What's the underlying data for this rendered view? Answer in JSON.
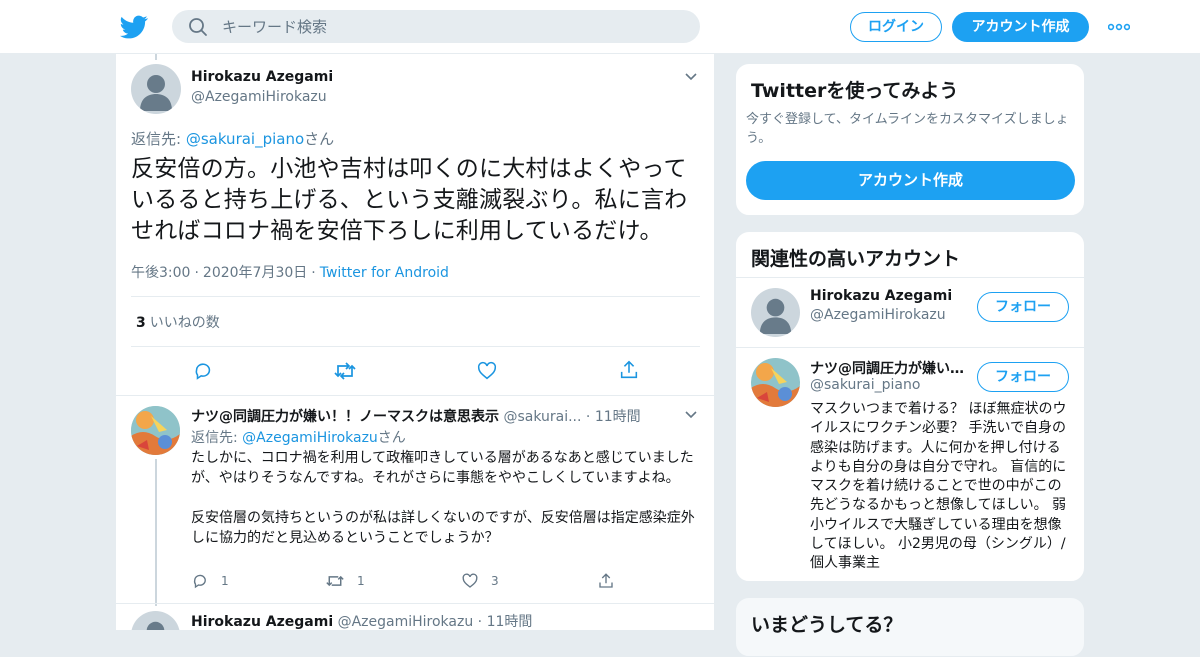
{
  "header": {
    "search_placeholder": "キーワード検索",
    "login_label": "ログイン",
    "signup_label": "アカウント作成",
    "brand_color": "#1da1f2"
  },
  "focus_tweet": {
    "name": "Hirokazu Azegami",
    "handle": "@AzegamiHirokazu",
    "reply_prefix": "返信先: ",
    "reply_handle": "@sakurai_piano",
    "reply_suffix": "さん",
    "text": "反安倍の方。小池や吉村は叩くのに大村はよくやっているると持ち上げる、という支離滅裂ぶり。私に言わせればコロナ禍を安倍下ろしに利用しているだけ。",
    "time": "午後3:00",
    "date": "2020年7月30日",
    "source": "Twitter for Android",
    "likes_count": "3",
    "likes_label": "いいねの数"
  },
  "reply_tweet": {
    "name": "ナツ@同調圧力が嫌い！！ノーマスクは意思表示",
    "handle": "@sakurai...",
    "time": "11時間",
    "reply_prefix": "返信先: ",
    "reply_handle": "@AzegamiHirokazu",
    "reply_suffix": "さん",
    "paragraph1": "たしかに、コロナ禍を利用して政権叩きしている層があるなあと感じていましたが、やはりそうなんですね。それがさらに事態をややこしくしていますよね。",
    "paragraph2": "反安倍層の気持ちというのが私は詳しくないのですが、反安倍層は指定感染症外しに協力的だと見込めるということでしょうか？",
    "reply_count": "1",
    "retweet_count": "1",
    "like_count": "3"
  },
  "next_tweet": {
    "name": "Hirokazu Azegami",
    "handle": "@AzegamiHirokazu",
    "time": "11時間"
  },
  "sidebar": {
    "signup_card": {
      "title": "Twitterを使ってみよう",
      "description": "今すぐ登録して、タイムラインをカスタマイズしましょう。",
      "button": "アカウント作成"
    },
    "related": {
      "title": "関連性の高いアカウント",
      "accounts": [
        {
          "name": "Hirokazu Azegami",
          "handle": "@AzegamiHirokazu",
          "follow": "フォロー"
        },
        {
          "name": "ナツ@同調圧力が嫌い！！ノーマスクは意思表示",
          "handle": "@sakurai_piano",
          "follow": "フォロー",
          "bio": "マスクいつまで着ける？ ほぼ無症状のウイルスにワクチン必要？ 手洗いで自身の感染は防げます。人に何かを押し付けるよりも自分の身は自分で守れ。 盲信的にマスクを着け続けることで世の中がこの先どうなるかもっと想像してほしい。 弱小ウイルスで大騒ぎしている理由を想像してほしい。 小2男児の母（シングル）/個人事業主"
        }
      ]
    },
    "trends_title": "いまどうしてる？"
  }
}
